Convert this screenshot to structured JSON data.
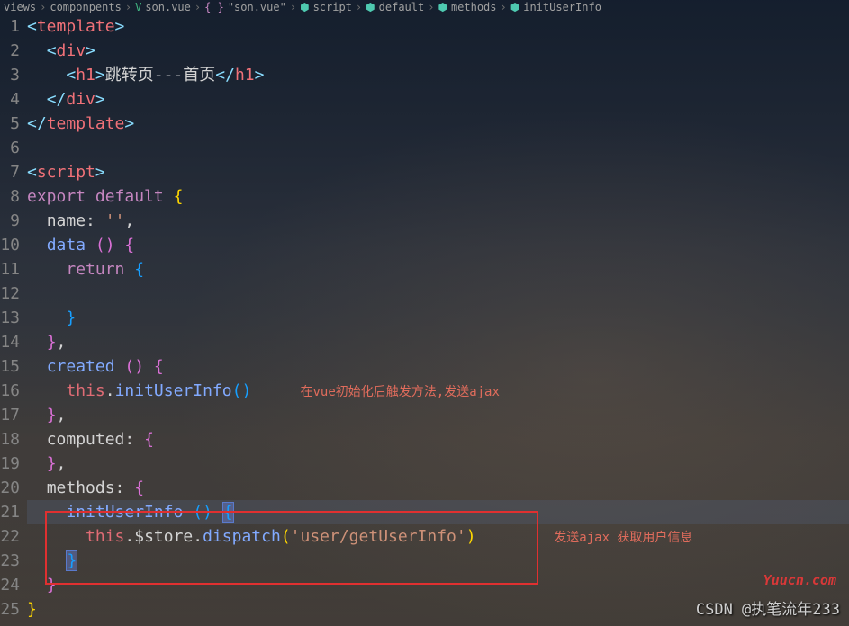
{
  "breadcrumb": {
    "items": [
      {
        "label": "views",
        "icon": ""
      },
      {
        "label": "componpents",
        "icon": ""
      },
      {
        "label": "son.vue",
        "icon": "vue"
      },
      {
        "label": "\"son.vue\"",
        "icon": "braces"
      },
      {
        "label": "script",
        "icon": "cube"
      },
      {
        "label": "default",
        "icon": "cube"
      },
      {
        "label": "methods",
        "icon": "cube"
      },
      {
        "label": "initUserInfo",
        "icon": "cube"
      }
    ]
  },
  "lines": {
    "1": {
      "num": "1"
    },
    "2": {
      "num": "2"
    },
    "3": {
      "num": "3",
      "h1_text": "跳转页---首页"
    },
    "4": {
      "num": "4"
    },
    "5": {
      "num": "5"
    },
    "6": {
      "num": "6"
    },
    "7": {
      "num": "7"
    },
    "8": {
      "num": "8",
      "export": "export",
      "default": "default"
    },
    "9": {
      "num": "9",
      "name": "name",
      "val": "''"
    },
    "10": {
      "num": "10",
      "data": "data"
    },
    "11": {
      "num": "11",
      "return": "return"
    },
    "12": {
      "num": "12"
    },
    "13": {
      "num": "13"
    },
    "14": {
      "num": "14"
    },
    "15": {
      "num": "15",
      "created": "created"
    },
    "16": {
      "num": "16",
      "this": "this",
      "method": "initUserInfo",
      "comment": "在vue初始化后触发方法,发送ajax"
    },
    "17": {
      "num": "17"
    },
    "18": {
      "num": "18",
      "computed": "computed"
    },
    "19": {
      "num": "19"
    },
    "20": {
      "num": "20",
      "methods": "methods"
    },
    "21": {
      "num": "21",
      "method": "initUserInfo"
    },
    "22": {
      "num": "22",
      "this": "this",
      "store": "$store",
      "dispatch": "dispatch",
      "arg": "'user/getUserInfo'",
      "comment": "发送ajax 获取用户信息"
    },
    "23": {
      "num": "23"
    },
    "24": {
      "num": "24"
    },
    "25": {
      "num": "25"
    }
  },
  "tags": {
    "template": "template",
    "div": "div",
    "h1": "h1",
    "script": "script"
  },
  "watermarks": {
    "w1": "Yuucn.com",
    "w2": "CSDN @执笔流年233"
  }
}
